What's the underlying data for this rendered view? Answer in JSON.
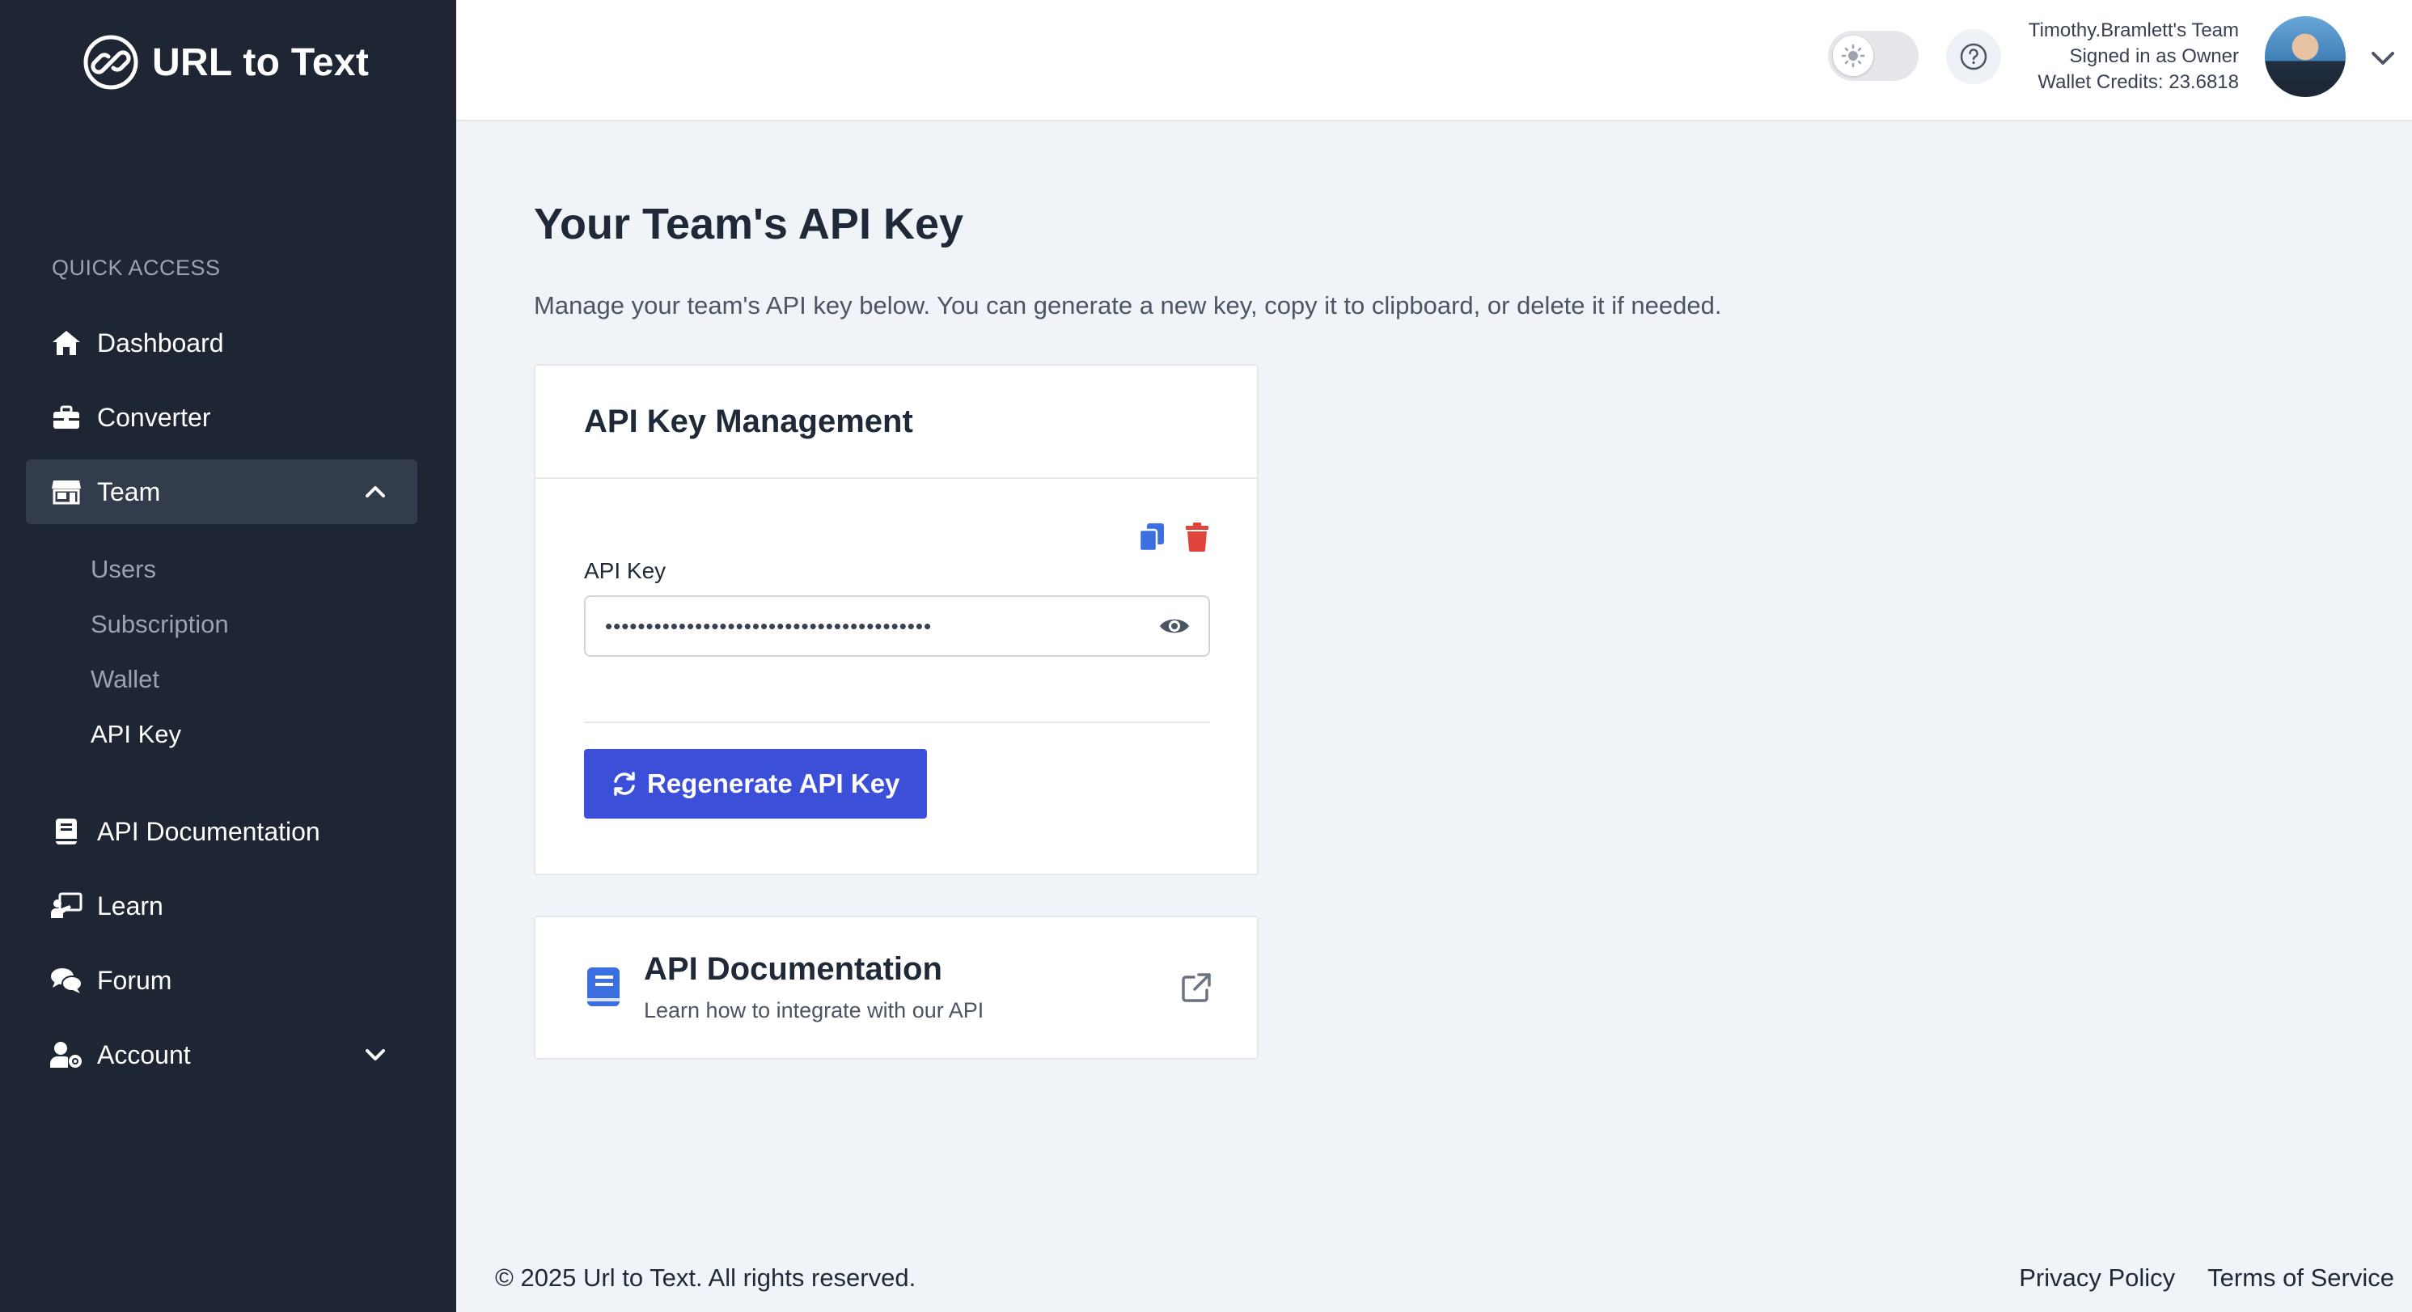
{
  "brand": {
    "name": "URL to Text"
  },
  "sidebar": {
    "section_label": "QUICK ACCESS",
    "items": {
      "dashboard": {
        "label": "Dashboard",
        "icon": "home-icon"
      },
      "converter": {
        "label": "Converter",
        "icon": "toolbox-icon"
      },
      "team": {
        "label": "Team",
        "icon": "store-icon",
        "expanded": true
      },
      "api_docs": {
        "label": "API Documentation",
        "icon": "book-icon"
      },
      "learn": {
        "label": "Learn",
        "icon": "chalkboard-icon"
      },
      "forum": {
        "label": "Forum",
        "icon": "comments-icon"
      },
      "account": {
        "label": "Account",
        "icon": "user-cog-icon",
        "expanded": false
      }
    },
    "team_subitems": {
      "users": "Users",
      "subscription": "Subscription",
      "wallet": "Wallet",
      "api_key": "API Key"
    }
  },
  "header": {
    "team_name": "Timothy.Bramlett's Team",
    "role": "Signed in as Owner",
    "credits": "Wallet Credits: 23.6818"
  },
  "main": {
    "title": "Your Team's API Key",
    "description": "Manage your team's API key below. You can generate a new key, copy it to clipboard, or delete it if needed.",
    "key_card": {
      "title": "API Key Management",
      "field_label": "API Key",
      "field_value": "••••••••••••••••••••••••••••••••••••••••",
      "regen_label": "Regenerate API Key"
    },
    "doc_card": {
      "title": "API Documentation",
      "subtitle": "Learn how to integrate with our API"
    }
  },
  "footer": {
    "copyright": "© 2025 Url to Text. All rights reserved.",
    "privacy": "Privacy Policy",
    "terms": "Terms of Service"
  },
  "colors": {
    "sidebar_bg": "#1e2533",
    "accent": "#3b4fd9",
    "copy_icon": "#3b6fe0",
    "delete_icon": "#e0443a"
  }
}
